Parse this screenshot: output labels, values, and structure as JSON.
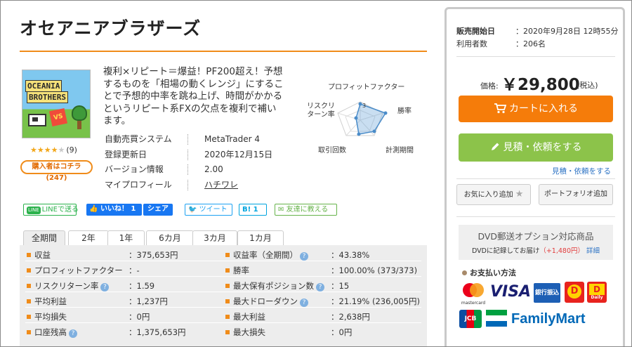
{
  "product": {
    "title": "オセアニアブラザーズ",
    "thumb_logo_line1": "OCEANIA",
    "thumb_logo_line2": "BROTHERS",
    "thumb_badge": "VS",
    "rating_count": "(9)",
    "buyers_badge": "購入者はコチラ(247)",
    "description": "複利×リピート＝爆益！PF200超え！予想するものを「相場の動くレンジ」にすることで予想的中率を跳ね上げ、時間がかかるというリピート系FXの欠点を複利で補います。",
    "info": [
      {
        "key": "自動売買システム",
        "value": "MetaTrader 4"
      },
      {
        "key": "登録更新日",
        "value": "2020年12月15日"
      },
      {
        "key": "バージョン情報",
        "value": "2.00"
      },
      {
        "key": "マイプロフィール",
        "value": "ハチワレ"
      }
    ]
  },
  "rating": {
    "value": 4,
    "max": 5
  },
  "radar": {
    "labels": [
      "プロフィットファクター",
      "勝率",
      "計測期間",
      "取引回数",
      "リスクリターン率"
    ],
    "scale_label": "3"
  },
  "share": {
    "line": "LINEで送る",
    "line_icon": "LINE",
    "fb_like": "いいね！ 1",
    "fb_share": "シェア",
    "tweet": "ツイート",
    "hatena": "B! 1",
    "mail": "友達に教える"
  },
  "tabs": [
    "全期間",
    "2年",
    "1年",
    "6カ月",
    "3カ月",
    "1カ月"
  ],
  "stats": {
    "left": [
      {
        "label": "収益",
        "value": "：375,653円",
        "help": false
      },
      {
        "label": "プロフィットファクター",
        "value": "：-",
        "help": false
      },
      {
        "label": "リスクリターン率",
        "value": "：1.59",
        "help": true
      },
      {
        "label": "平均利益",
        "value": "：1,237円",
        "help": false
      },
      {
        "label": "平均損失",
        "value": "：0円",
        "help": false
      },
      {
        "label": "口座残高",
        "value": "：1,375,653円",
        "help": true
      }
    ],
    "right": [
      {
        "label": "収益率（全期間）",
        "value": "：43.38%",
        "help": true
      },
      {
        "label": "勝率",
        "value": "：100.00% (373/373)",
        "help": false
      },
      {
        "label": "最大保有ポジション数",
        "value": "：15",
        "help": true
      },
      {
        "label": "最大ドローダウン",
        "value": "：21.19% (236,005円)",
        "help": true
      },
      {
        "label": "最大利益",
        "value": "：2,638円",
        "help": false
      },
      {
        "label": "最大損失",
        "value": "：0円",
        "help": false
      }
    ]
  },
  "panel": {
    "sale_start_label": "販売開始日",
    "sale_start_value": "：2020年9月28日 12時55分",
    "users_label": "利用者数",
    "users_value": "：206名",
    "price_label": "価格:",
    "price": "￥29,800",
    "tax": "(税込)",
    "cart_button": "カートに入れる",
    "estimate_button": "見積・依頼をする",
    "estimate_link": "見積・依頼をする",
    "favorite_button": "お気に入り追加",
    "portfolio_button": "ポートフォリオ追加",
    "dvd_title": "DVD郵送オプション対応商品",
    "dvd_note": "DVDに記録してお届け",
    "dvd_price": "（+1,480円）",
    "dvd_detail": "詳細",
    "payment_title": "お支払い方法",
    "pay_mastercard": "mastercard",
    "pay_visa": "VISA",
    "pay_bank": "銀行振込",
    "pay_jcb": "JCB",
    "pay_familymart": "FamilyMart",
    "pay_daily": "Daily"
  },
  "colors": {
    "accent": "#f08c1a",
    "cart": "#f57c0a",
    "estimate": "#8cc34a",
    "link": "#2d73c4"
  },
  "icons": {
    "cart": "cart-icon",
    "pencil": "pencil-icon",
    "star": "star-icon",
    "help": "help-icon",
    "twitter": "twitter-bird-icon",
    "mail": "mail-icon",
    "facebook": "facebook-thumb-icon"
  }
}
